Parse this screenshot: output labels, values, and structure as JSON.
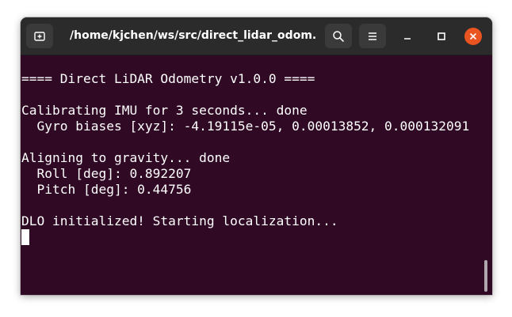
{
  "window": {
    "title": "/home/kjchen/ws/src/direct_lidar_odom...",
    "accent_color": "#e95420",
    "background_color": "#300a24"
  },
  "titlebar": {
    "new_tab_icon": "new-tab-icon",
    "search_icon": "search-icon",
    "menu_icon": "hamburger-menu-icon",
    "minimize_icon": "minimize-icon",
    "maximize_icon": "maximize-icon",
    "close_icon": "close-icon"
  },
  "terminal": {
    "lines": [
      "",
      "==== Direct LiDAR Odometry v1.0.0 ====",
      "",
      "Calibrating IMU for 3 seconds... done",
      "  Gyro biases [xyz]: -4.19115e-05, 0.00013852, 0.000132091",
      "",
      "Aligning to gravity... done",
      "  Roll [deg]: 0.892207",
      "  Pitch [deg]: 0.44756",
      "",
      "DLO initialized! Starting localization..."
    ]
  }
}
